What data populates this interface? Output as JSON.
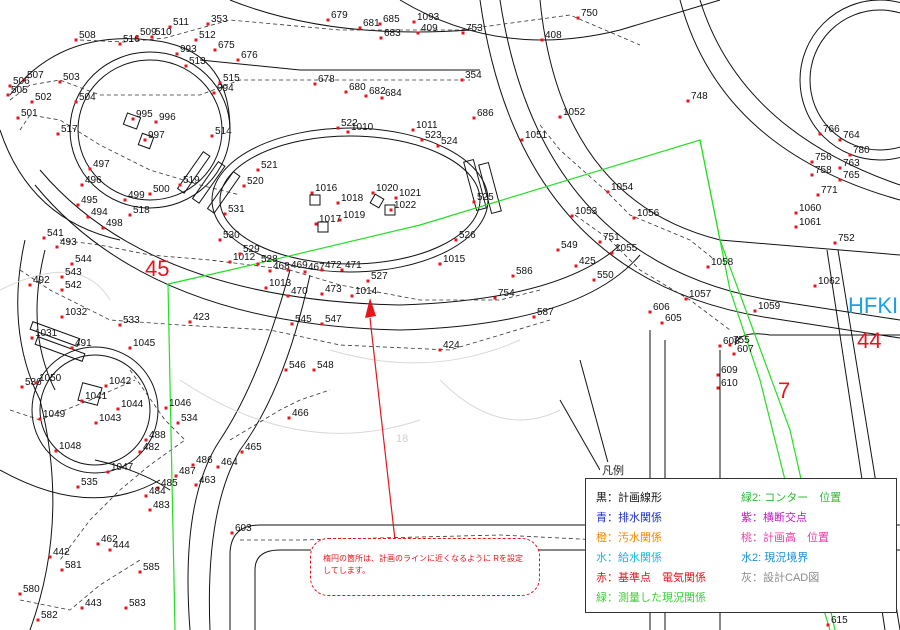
{
  "points": [
    {
      "id": "353"
    },
    {
      "id": "511"
    },
    {
      "id": "508"
    },
    {
      "id": "516"
    },
    {
      "id": "509"
    },
    {
      "id": "510"
    },
    {
      "id": "512"
    },
    {
      "id": "993"
    },
    {
      "id": "513"
    },
    {
      "id": "675"
    },
    {
      "id": "676"
    },
    {
      "id": "679"
    },
    {
      "id": "681"
    },
    {
      "id": "685"
    },
    {
      "id": "683"
    },
    {
      "id": "1093"
    },
    {
      "id": "409"
    },
    {
      "id": "753"
    },
    {
      "id": "408"
    },
    {
      "id": "750"
    },
    {
      "id": "678"
    },
    {
      "id": "680"
    },
    {
      "id": "682"
    },
    {
      "id": "684"
    },
    {
      "id": "354"
    },
    {
      "id": "507"
    },
    {
      "id": "506"
    },
    {
      "id": "505"
    },
    {
      "id": "502"
    },
    {
      "id": "503"
    },
    {
      "id": "504"
    },
    {
      "id": "501"
    },
    {
      "id": "515"
    },
    {
      "id": "994"
    },
    {
      "id": "995"
    },
    {
      "id": "996"
    },
    {
      "id": "997"
    },
    {
      "id": "517"
    },
    {
      "id": "514"
    },
    {
      "id": "748"
    },
    {
      "id": "686"
    },
    {
      "id": "522"
    },
    {
      "id": "1010"
    },
    {
      "id": "1011"
    },
    {
      "id": "523"
    },
    {
      "id": "524"
    },
    {
      "id": "1051"
    },
    {
      "id": "1052"
    },
    {
      "id": "766"
    },
    {
      "id": "764"
    },
    {
      "id": "756"
    },
    {
      "id": "780"
    },
    {
      "id": "758"
    },
    {
      "id": "763"
    },
    {
      "id": "765"
    },
    {
      "id": "771"
    },
    {
      "id": "497"
    },
    {
      "id": "496"
    },
    {
      "id": "499"
    },
    {
      "id": "500"
    },
    {
      "id": "519"
    },
    {
      "id": "521"
    },
    {
      "id": "520"
    },
    {
      "id": "495"
    },
    {
      "id": "494"
    },
    {
      "id": "498"
    },
    {
      "id": "518"
    },
    {
      "id": "531"
    },
    {
      "id": "1016"
    },
    {
      "id": "1018"
    },
    {
      "id": "1020"
    },
    {
      "id": "1021"
    },
    {
      "id": "1022"
    },
    {
      "id": "1017"
    },
    {
      "id": "1019"
    },
    {
      "id": "525"
    },
    {
      "id": "1054"
    },
    {
      "id": "1053"
    },
    {
      "id": "1056"
    },
    {
      "id": "1060"
    },
    {
      "id": "1061"
    },
    {
      "id": "752"
    },
    {
      "id": "541"
    },
    {
      "id": "493"
    },
    {
      "id": "530"
    },
    {
      "id": "526"
    },
    {
      "id": "549"
    },
    {
      "id": "751"
    },
    {
      "id": "1055"
    },
    {
      "id": "1058"
    },
    {
      "id": "1012"
    },
    {
      "id": "529"
    },
    {
      "id": "528"
    },
    {
      "id": "468"
    },
    {
      "id": "469"
    },
    {
      "id": "467"
    },
    {
      "id": "472"
    },
    {
      "id": "471"
    },
    {
      "id": "527"
    },
    {
      "id": "1015"
    },
    {
      "id": "492"
    },
    {
      "id": "544"
    },
    {
      "id": "543"
    },
    {
      "id": "542"
    },
    {
      "id": "1013"
    },
    {
      "id": "470"
    },
    {
      "id": "473"
    },
    {
      "id": "1014"
    },
    {
      "id": "586"
    },
    {
      "id": "425"
    },
    {
      "id": "550"
    },
    {
      "id": "754"
    },
    {
      "id": "1057"
    },
    {
      "id": "1062"
    },
    {
      "id": "1059"
    },
    {
      "id": "1032"
    },
    {
      "id": "1031"
    },
    {
      "id": "533"
    },
    {
      "id": "491"
    },
    {
      "id": "423"
    },
    {
      "id": "545"
    },
    {
      "id": "547"
    },
    {
      "id": "587"
    },
    {
      "id": "606"
    },
    {
      "id": "605"
    },
    {
      "id": "1045"
    },
    {
      "id": "424"
    },
    {
      "id": "608"
    },
    {
      "id": "755"
    },
    {
      "id": "607"
    },
    {
      "id": "536"
    },
    {
      "id": "1050"
    },
    {
      "id": "1042"
    },
    {
      "id": "1041"
    },
    {
      "id": "1044"
    },
    {
      "id": "546"
    },
    {
      "id": "548"
    },
    {
      "id": "609"
    },
    {
      "id": "610"
    },
    {
      "id": "1046"
    },
    {
      "id": "1049"
    },
    {
      "id": "1043"
    },
    {
      "id": "534"
    },
    {
      "id": "466"
    },
    {
      "id": "488"
    },
    {
      "id": "1048"
    },
    {
      "id": "482"
    },
    {
      "id": "465"
    },
    {
      "id": "486"
    },
    {
      "id": "464"
    },
    {
      "id": "1047"
    },
    {
      "id": "487"
    },
    {
      "id": "463"
    },
    {
      "id": "535"
    },
    {
      "id": "485"
    },
    {
      "id": "484"
    },
    {
      "id": "483"
    },
    {
      "id": "603"
    },
    {
      "id": "462"
    },
    {
      "id": "444"
    },
    {
      "id": "442"
    },
    {
      "id": "581"
    },
    {
      "id": "585"
    },
    {
      "id": "580"
    },
    {
      "id": "443"
    },
    {
      "id": "583"
    },
    {
      "id": "582"
    },
    {
      "id": "611"
    },
    {
      "id": "615"
    }
  ],
  "area_labels": {
    "a45": "45",
    "a44": "44",
    "a7": "7",
    "hfk": "HFKI"
  },
  "faint_labels": {
    "f18": "18"
  },
  "legend": {
    "title": "凡例",
    "rows": [
      {
        "text": "黒：計画線形",
        "color": "#111111"
      },
      {
        "text": "青：排水関係",
        "color": "#1f2fd6"
      },
      {
        "text": "橙：汚水関係",
        "color": "#f08a00"
      },
      {
        "text": "水：給水関係",
        "color": "#19b8e6"
      },
      {
        "text": "赤：基準点　電気関係",
        "color": "#e8141b"
      },
      {
        "text": "緑：測量した現況関係",
        "color": "#3ad13a"
      },
      {
        "text": "緑2: コンター　位置",
        "color": "#2fb83a"
      },
      {
        "text": "紫：横断交点",
        "color": "#c01cc0"
      },
      {
        "text": "桃：計画高　位置",
        "color": "#ef3ea6"
      },
      {
        "text": "水2: 現況境界",
        "color": "#1a8fd8"
      },
      {
        "text": "灰：設計CAD図",
        "color": "#8a8a8a"
      }
    ]
  },
  "note": {
    "text": "楕円の箇所は、計画のラインに近くなるように Rを設定してします。"
  },
  "colors": {
    "plan_line": "#111111",
    "survey_green": "#23e023",
    "point_red": "#e8141b",
    "annotation_red": "#e8141b"
  }
}
